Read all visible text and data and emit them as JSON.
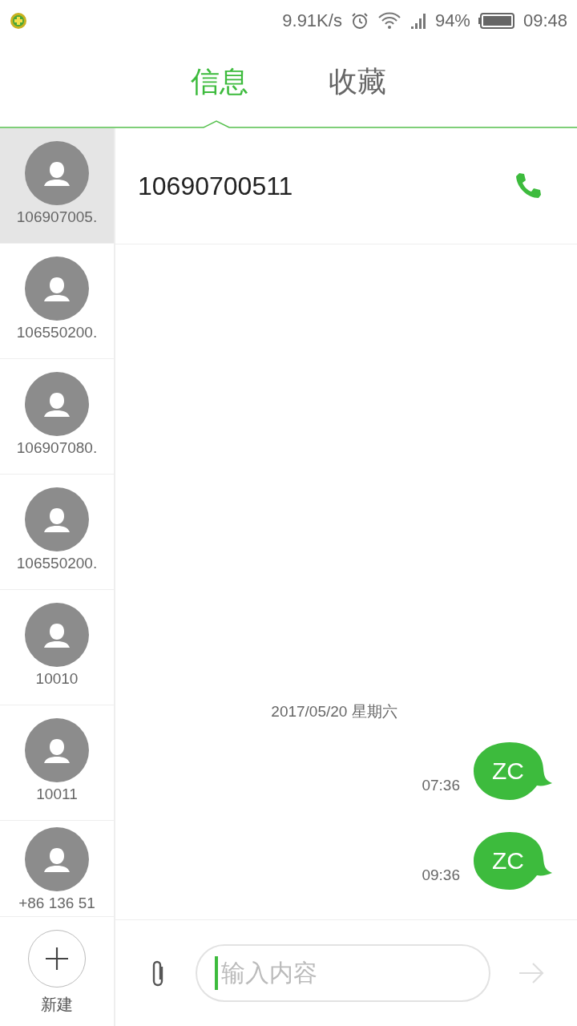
{
  "status_bar": {
    "speed": "9.91K/s",
    "battery": "94%",
    "time": "09:48"
  },
  "tabs": [
    {
      "label": "信息",
      "selected": true
    },
    {
      "label": "收藏",
      "selected": false
    }
  ],
  "contacts": [
    {
      "name": "106907005.",
      "selected": true
    },
    {
      "name": "106550200.",
      "selected": false
    },
    {
      "name": "106907080.",
      "selected": false
    },
    {
      "name": "106550200.",
      "selected": false
    },
    {
      "name": "10010",
      "selected": false
    },
    {
      "name": "10011",
      "selected": false
    },
    {
      "name": "+86 136 51",
      "selected": false
    }
  ],
  "new_button": {
    "label": "新建"
  },
  "conversation": {
    "title": "10690700511",
    "date": "2017/05/20  星期六",
    "messages": [
      {
        "time": "07:36",
        "text": "ZC"
      },
      {
        "time": "09:36",
        "text": "ZC"
      }
    ]
  },
  "composer": {
    "placeholder": "输入内容"
  }
}
